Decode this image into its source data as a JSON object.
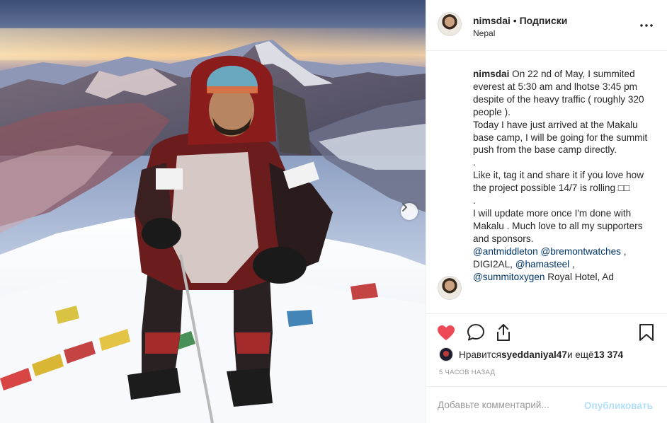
{
  "post": {
    "username": "nimsdai",
    "follow_separator": "•",
    "follow_label": "Подписки",
    "location": "Nepal",
    "more_icon": "more-horizontal-icon"
  },
  "caption": {
    "username": "nimsdai",
    "text": " On 22 nd of May, I summited everest at 5:30 am and lhotse 3:45 pm despite of the heavy traffic ( roughly 320 people ).\nToday I have just arrived at the Makalu base camp, I will be going for the summit push from the base camp directly.\n.\nLike it, tag it and share it if you love how the project possible 14/7 is rolling □□\n.\nI will update more once I'm done with Makalu . Much love to all my supporters and sponsors.\n",
    "mention_1": "@antmiddleton",
    "space_1": " ",
    "mention_2": "@bremontwatches",
    "text_after_2": " ,\nDIGI2AL, ",
    "mention_3": "@hamasteel",
    "text_after_3": " ,\n",
    "mention_4": "@summitoxygen",
    "text_after_4": " Royal Hotel, Ad"
  },
  "actions": {
    "like_icon": "heart-filled-icon",
    "comment_icon": "comment-icon",
    "share_icon": "share-icon",
    "save_icon": "bookmark-icon",
    "like_color": "#ed4956"
  },
  "likes": {
    "prefix": "Нравится ",
    "user": "syeddaniyal47",
    "middle": " и ещё ",
    "count": "13 374"
  },
  "timestamp": "5 часов назад",
  "comment": {
    "placeholder": "Добавьте комментарий...",
    "publish_label": "Опубликовать",
    "publish_color": "#b2dffc"
  },
  "photo": {
    "description_icon": "mountain-photo",
    "next_icon": "chevron-right-icon"
  }
}
